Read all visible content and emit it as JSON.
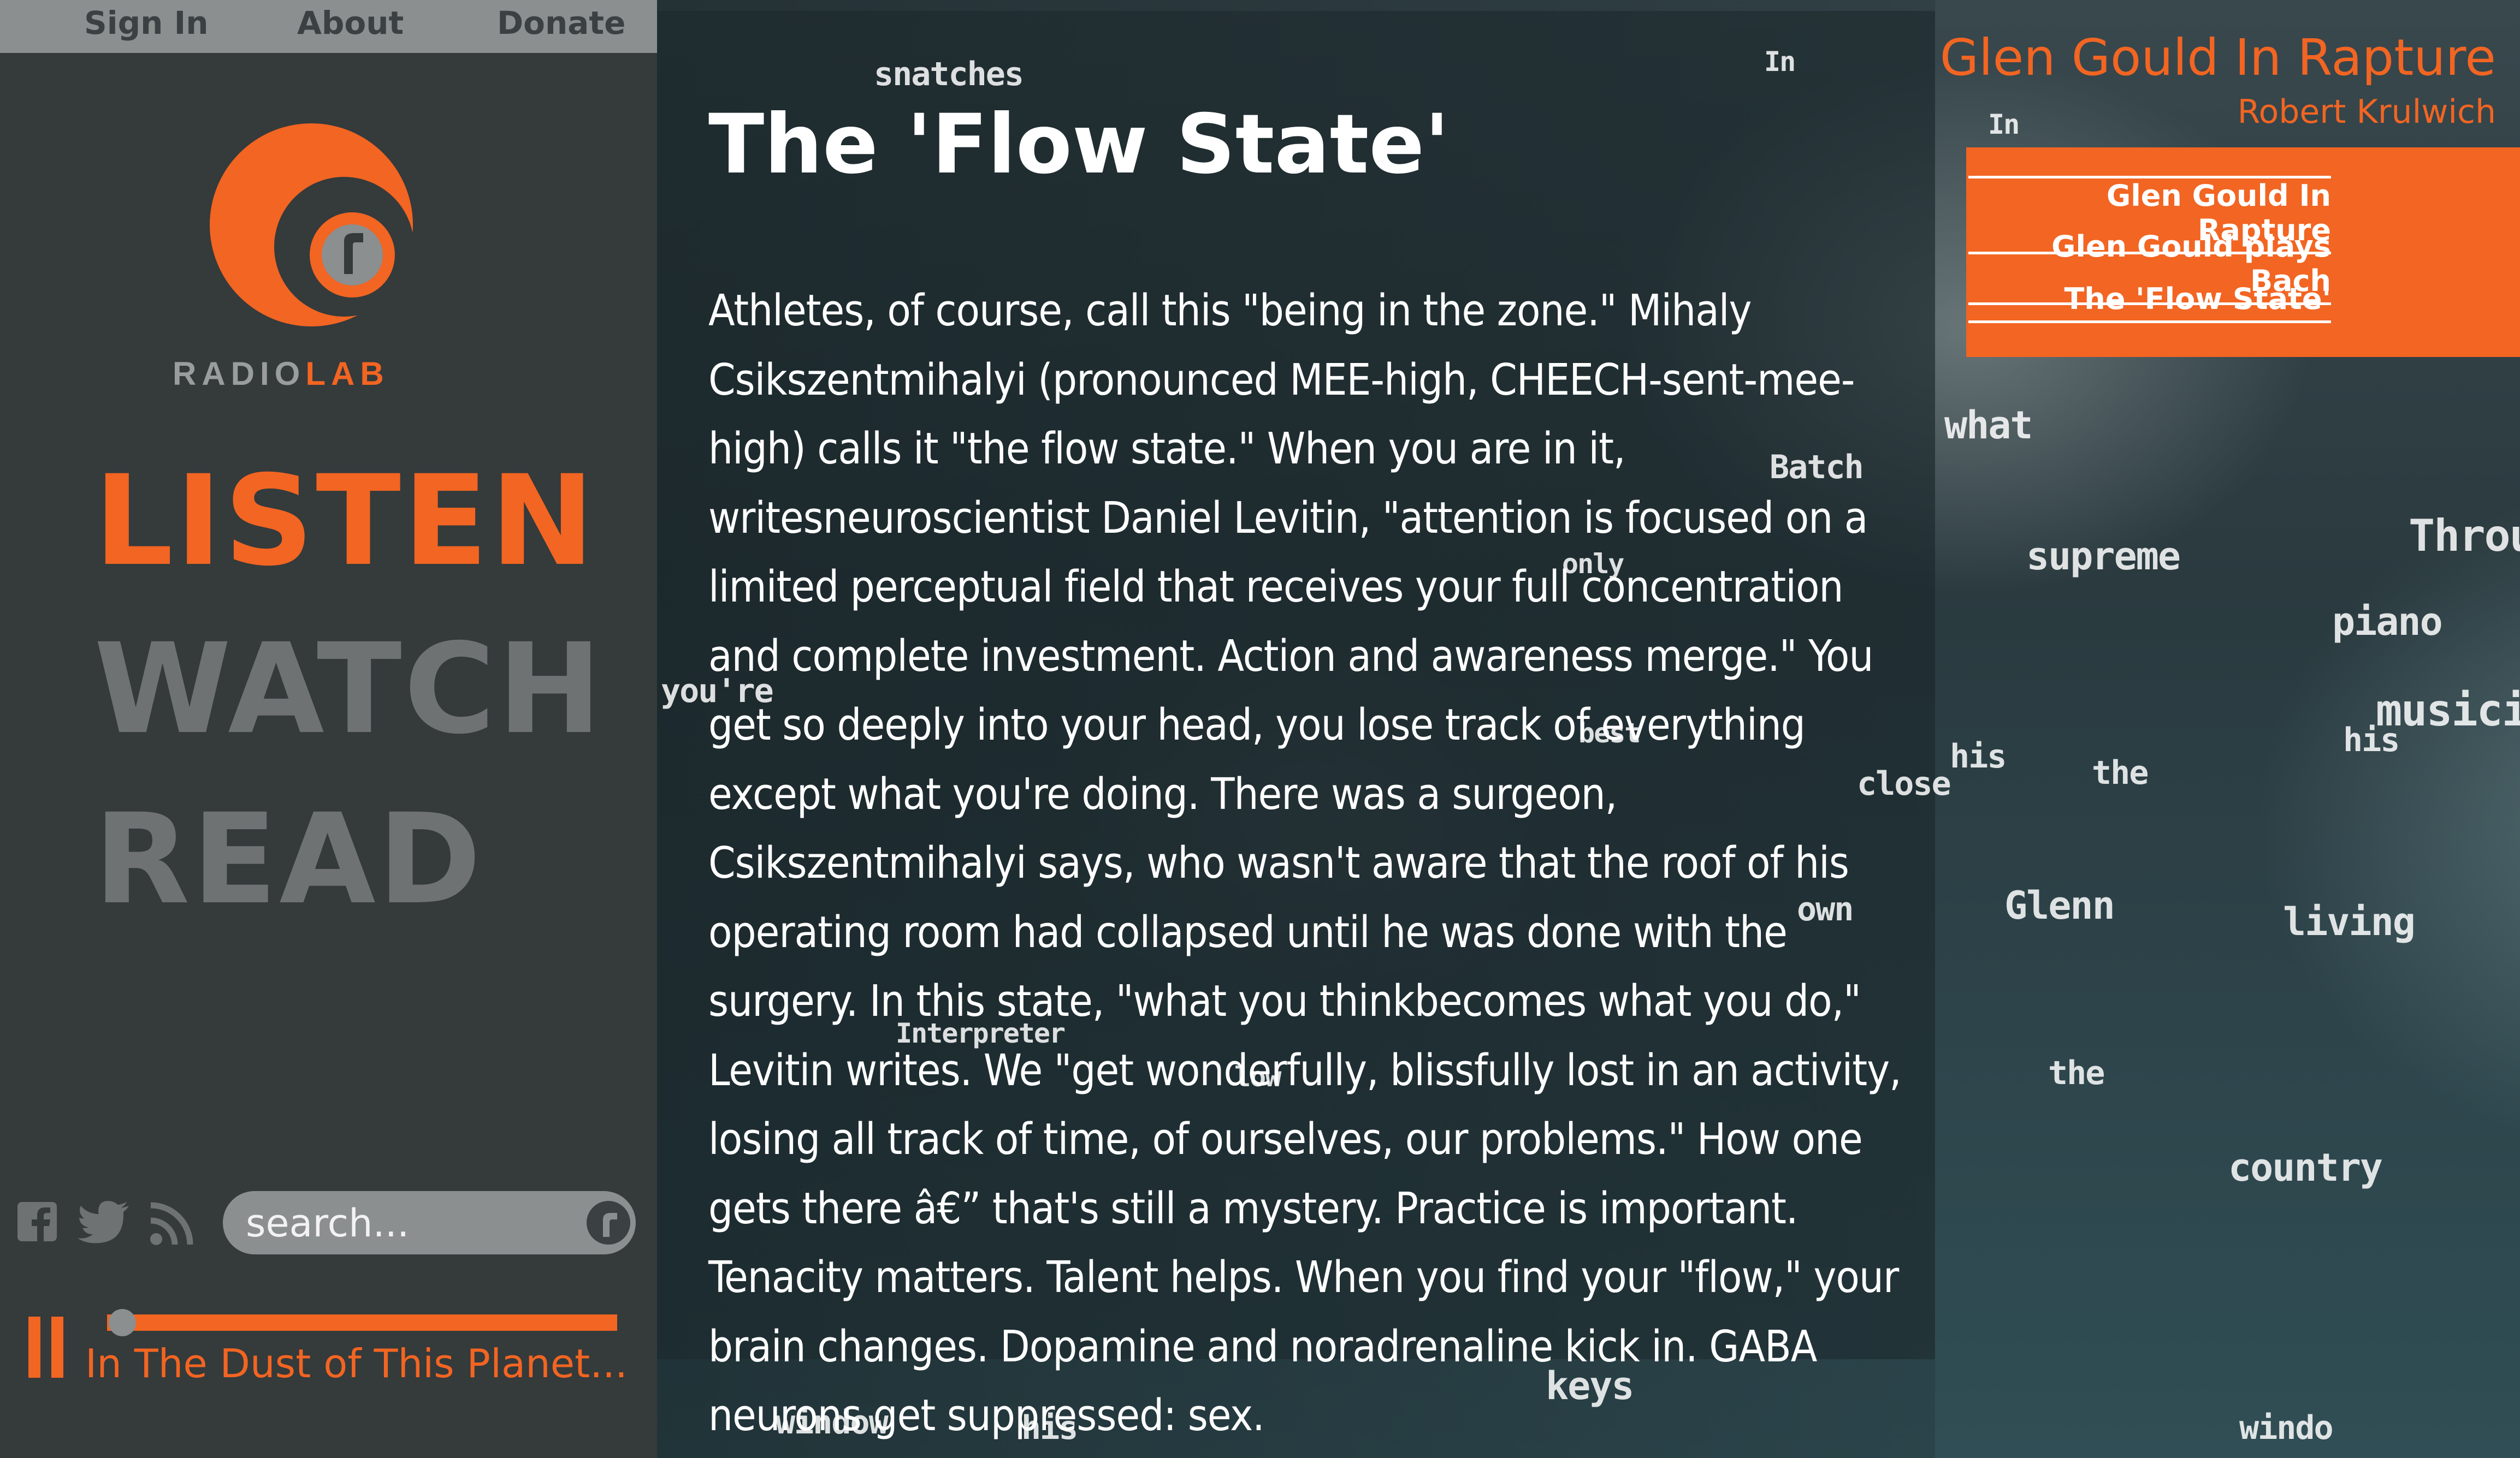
{
  "nav": {
    "sign_in": "Sign In",
    "about": "About",
    "donate": "Donate"
  },
  "logo": {
    "radio": "RADIO",
    "lab": "LAB"
  },
  "menu": {
    "listen": "LISTEN",
    "watch": "WATCH",
    "read": "READ"
  },
  "search": {
    "placeholder": "search..."
  },
  "player": {
    "now_playing": "In The Dust of This Planet...",
    "progress": 0.03
  },
  "article": {
    "title": "The 'Flow State'",
    "body": "Athletes, of course, call this \"being in the zone.\" Mihaly Csikszentmihalyi (pronounced MEE-high, CHEECH-sent-mee-high) calls it \"the flow state.\" When you are in it, writesneuroscientist Daniel Levitin, \"attention is focused on a limited perceptual field that receives your full concentration and complete investment. Action and awareness merge.\" You get so deeply into your head, you lose track of everything except what you're doing. There was a surgeon, Csikszentmihalyi says, who wasn't aware that the roof of his operating room had collapsed until he was done with the surgery. In this state, \"what you thinkbecomes what you do,\" Levitin writes. We \"get wonderfully, blissfully lost in an activity, losing all track of time, of ourselves, our problems.\" How one gets there â€” that's still a mystery. Practice is important. Tenacity matters. Talent helps. When you find your \"flow,\" your brain changes. Dopamine and noradrenaline kick in. GABA neurons get suppressed: sex."
  },
  "header": {
    "title": "Glen Gould In Rapture",
    "author": "Robert Krulwich"
  },
  "toc": [
    "Glen Gould In Rapture",
    "Glen Gould plays Bach",
    "The 'Flow State'"
  ],
  "floating_words": [
    "snatches",
    "In",
    "In",
    "what",
    "supreme",
    "Through",
    "piano",
    "musician",
    "his",
    "the",
    "his",
    "Glenn",
    "living",
    "the",
    "country",
    "you're",
    "close",
    "window",
    "his",
    "keys",
    "windo",
    "Interpreter",
    "Batch",
    "only",
    "best",
    "low",
    "own"
  ],
  "colors": {
    "accent": "#f26522",
    "sidebar": "#353a3b",
    "nav": "#8b8f8f",
    "inactive_menu": "#6f7273"
  }
}
